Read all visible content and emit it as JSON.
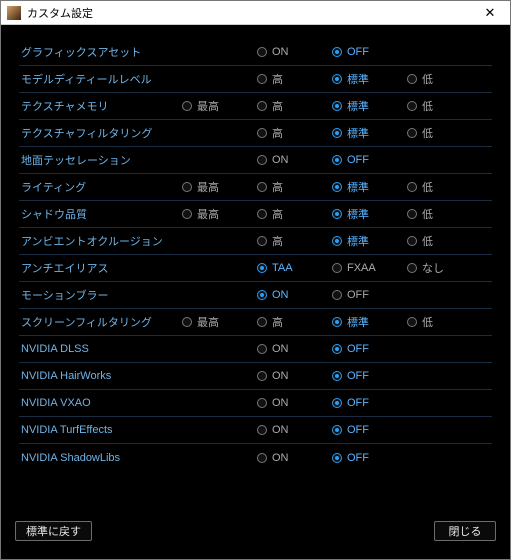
{
  "window": {
    "title": "カスタム設定"
  },
  "levels": {
    "best": "最高",
    "high": "高",
    "standard": "標準",
    "low": "低",
    "on": "ON",
    "off": "OFF",
    "taa": "TAA",
    "fxaa": "FXAA",
    "none": "なし"
  },
  "rows": [
    {
      "label": "グラフィックスアセット",
      "options": [
        "",
        "on",
        "off",
        ""
      ],
      "selected": "off"
    },
    {
      "label": "モデルディティールレベル",
      "options": [
        "",
        "high",
        "standard",
        "low"
      ],
      "selected": "standard"
    },
    {
      "label": "テクスチャメモリ",
      "options": [
        "best",
        "high",
        "standard",
        "low"
      ],
      "selected": "standard"
    },
    {
      "label": "テクスチャフィルタリング",
      "options": [
        "",
        "high",
        "standard",
        "low"
      ],
      "selected": "standard"
    },
    {
      "label": "地面テッセレーション",
      "options": [
        "",
        "on",
        "off",
        ""
      ],
      "selected": "off"
    },
    {
      "label": "ライティング",
      "options": [
        "best",
        "high",
        "standard",
        "low"
      ],
      "selected": "standard"
    },
    {
      "label": "シャドウ品質",
      "options": [
        "best",
        "high",
        "standard",
        "low"
      ],
      "selected": "standard"
    },
    {
      "label": "アンビエントオクルージョン",
      "options": [
        "",
        "high",
        "standard",
        "low"
      ],
      "selected": "standard"
    },
    {
      "label": "アンチエイリアス",
      "options": [
        "",
        "taa",
        "fxaa",
        "none"
      ],
      "selected": "taa"
    },
    {
      "label": "モーションブラー",
      "options": [
        "",
        "on",
        "off",
        ""
      ],
      "selected": "on"
    },
    {
      "label": "スクリーンフィルタリング",
      "options": [
        "best",
        "high",
        "standard",
        "low"
      ],
      "selected": "standard"
    },
    {
      "label": "NVIDIA DLSS",
      "options": [
        "",
        "on",
        "off",
        ""
      ],
      "selected": "off"
    },
    {
      "label": "NVIDIA HairWorks",
      "options": [
        "",
        "on",
        "off",
        ""
      ],
      "selected": "off"
    },
    {
      "label": "NVIDIA VXAO",
      "options": [
        "",
        "on",
        "off",
        ""
      ],
      "selected": "off"
    },
    {
      "label": "NVIDIA TurfEffects",
      "options": [
        "",
        "on",
        "off",
        ""
      ],
      "selected": "off"
    },
    {
      "label": "NVIDIA ShadowLibs",
      "options": [
        "",
        "on",
        "off",
        ""
      ],
      "selected": "off"
    }
  ],
  "footer": {
    "reset": "標準に戻す",
    "close": "閉じる"
  }
}
